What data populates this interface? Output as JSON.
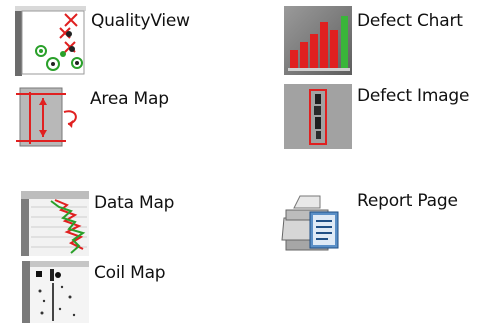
{
  "items": [
    {
      "label": "QualityView",
      "icon": "quality-view-icon"
    },
    {
      "label": "Defect Chart",
      "icon": "defect-chart-icon"
    },
    {
      "label": "Area Map",
      "icon": "area-map-icon"
    },
    {
      "label": "Defect Image",
      "icon": "defect-image-icon"
    },
    {
      "label": "Data Map",
      "icon": "data-map-icon"
    },
    {
      "label": "Report Page",
      "icon": "report-page-icon"
    },
    {
      "label": "Coil Map",
      "icon": "coil-map-icon"
    }
  ],
  "colors": {
    "text": "#111111",
    "red": "#e02020",
    "green": "#2aa02a",
    "gray": "#8c8c8c"
  }
}
